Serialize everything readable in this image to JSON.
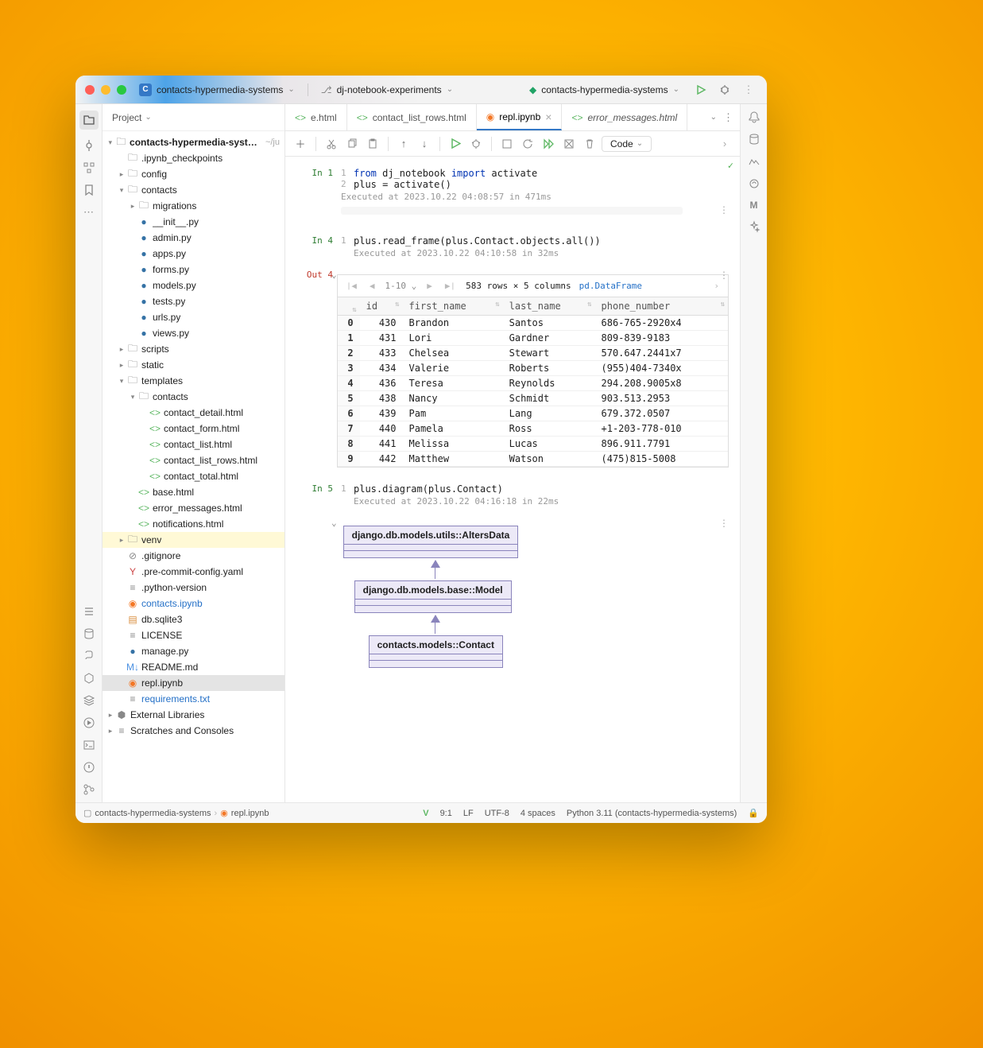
{
  "titlebar": {
    "project": "contacts-hypermedia-systems",
    "branch": "dj-notebook-experiments",
    "run_config": "contacts-hypermedia-systems"
  },
  "sidebar": {
    "header": "Project",
    "root_name": "contacts-hypermedia-systems",
    "root_meta": "~/ju",
    "tree": {
      "ipynb_checkpoints": ".ipynb_checkpoints",
      "config": "config",
      "contacts": "contacts",
      "migrations": "migrations",
      "files_contacts": [
        "__init__.py",
        "admin.py",
        "apps.py",
        "forms.py",
        "models.py",
        "tests.py",
        "urls.py",
        "views.py"
      ],
      "scripts": "scripts",
      "static": "static",
      "templates": "templates",
      "templates_contacts": "contacts",
      "html_files": [
        "contact_detail.html",
        "contact_form.html",
        "contact_list.html",
        "contact_list_rows.html",
        "contact_total.html"
      ],
      "root_html": [
        "base.html",
        "error_messages.html",
        "notifications.html"
      ],
      "venv": "venv",
      "gitignore": ".gitignore",
      "precommit": ".pre-commit-config.yaml",
      "pyver": ".python-version",
      "contacts_ipynb": "contacts.ipynb",
      "dbsqlite": "db.sqlite3",
      "license": "LICENSE",
      "manage": "manage.py",
      "readme": "README.md",
      "repl": "repl.ipynb",
      "reqs": "requirements.txt",
      "ext_lib": "External Libraries",
      "scratches": "Scratches and Consoles"
    }
  },
  "tabs": [
    {
      "label": "e.html",
      "kind": "html"
    },
    {
      "label": "contact_list_rows.html",
      "kind": "html"
    },
    {
      "label": "repl.ipynb",
      "kind": "ipynb",
      "active": true
    },
    {
      "label": "error_messages.html",
      "kind": "html",
      "italic": true
    }
  ],
  "toolbar": {
    "mode": "Code"
  },
  "cells": {
    "c1": {
      "prompt": "In 1",
      "lines": [
        "from dj_notebook import activate",
        "plus = activate()"
      ],
      "meta": "Executed at 2023.10.22 04:08:57 in 471ms"
    },
    "c2": {
      "prompt": "In 4",
      "line_no": "1",
      "code": "plus.read_frame(plus.Contact.objects.all())",
      "meta": "Executed at 2023.10.22 04:10:58 in 32ms",
      "out_prompt": "Out 4"
    },
    "c3": {
      "prompt": "In 5",
      "line_no": "1",
      "code": "plus.diagram(plus.Contact)",
      "meta": "Executed at 2023.10.22 04:16:18 in 22ms"
    }
  },
  "dataframe": {
    "pager": "1-10",
    "summary": "583 rows × 5 columns",
    "type": "pd.DataFrame",
    "columns": [
      "id",
      "first_name",
      "last_name",
      "phone_number"
    ],
    "rows": [
      {
        "i": "0",
        "id": "430",
        "fn": "Brandon",
        "ln": "Santos",
        "ph": "686-765-2920x4"
      },
      {
        "i": "1",
        "id": "431",
        "fn": "Lori",
        "ln": "Gardner",
        "ph": "809-839-9183"
      },
      {
        "i": "2",
        "id": "433",
        "fn": "Chelsea",
        "ln": "Stewart",
        "ph": "570.647.2441x7"
      },
      {
        "i": "3",
        "id": "434",
        "fn": "Valerie",
        "ln": "Roberts",
        "ph": "(955)404-7340x"
      },
      {
        "i": "4",
        "id": "436",
        "fn": "Teresa",
        "ln": "Reynolds",
        "ph": "294.208.9005x8"
      },
      {
        "i": "5",
        "id": "438",
        "fn": "Nancy",
        "ln": "Schmidt",
        "ph": "903.513.2953"
      },
      {
        "i": "6",
        "id": "439",
        "fn": "Pam",
        "ln": "Lang",
        "ph": "679.372.0507"
      },
      {
        "i": "7",
        "id": "440",
        "fn": "Pamela",
        "ln": "Ross",
        "ph": "+1-203-778-010"
      },
      {
        "i": "8",
        "id": "441",
        "fn": "Melissa",
        "ln": "Lucas",
        "ph": "896.911.7791"
      },
      {
        "i": "9",
        "id": "442",
        "fn": "Matthew",
        "ln": "Watson",
        "ph": "(475)815-5008"
      }
    ]
  },
  "uml": {
    "box1": "django.db.models.utils::AltersData",
    "box2": "django.db.models.base::Model",
    "box3": "contacts.models::Contact"
  },
  "status": {
    "crumb1": "contacts-hypermedia-systems",
    "crumb2": "repl.ipynb",
    "pos": "9:1",
    "le": "LF",
    "enc": "UTF-8",
    "indent": "4 spaces",
    "interp": "Python 3.11 (contacts-hypermedia-systems)"
  }
}
